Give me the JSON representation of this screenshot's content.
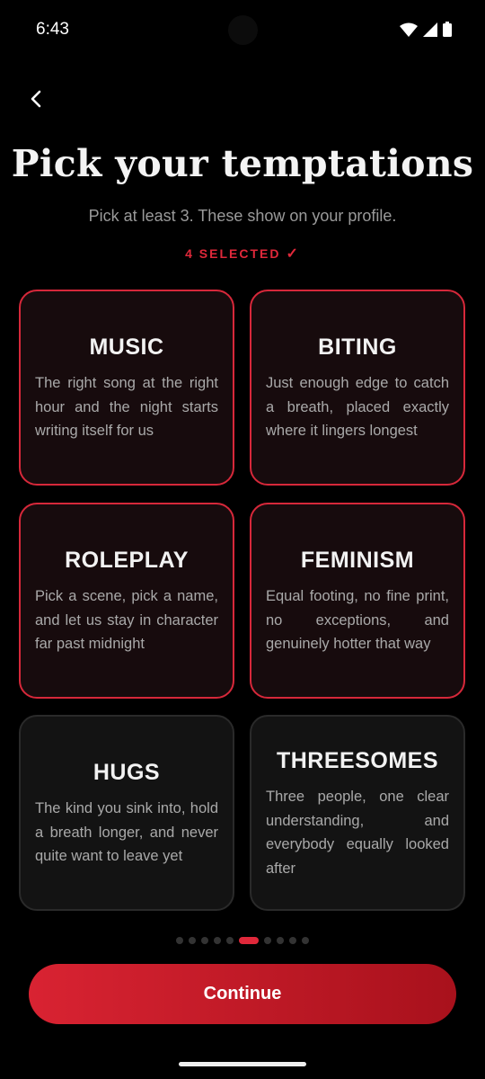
{
  "status_bar": {
    "time": "6:43",
    "icons": [
      "wifi-icon",
      "signal-icon",
      "battery-icon"
    ]
  },
  "header": {
    "back_icon": "chevron-left-icon",
    "title": "Pick your temptations",
    "subtitle": "Pick at least 3. These show on your profile.",
    "selected_text": "4 SELECTED",
    "selected_check": "✓"
  },
  "cards": [
    {
      "title": "MUSIC",
      "description": "The right song at the right hour and the night starts writing itself for us",
      "selected": true
    },
    {
      "title": "BITING",
      "description": "Just enough edge to catch a breath, placed exactly where it lingers longest",
      "selected": true
    },
    {
      "title": "ROLEPLAY",
      "description": "Pick a scene, pick a name, and let us stay in character far past midnight",
      "selected": true
    },
    {
      "title": "FEMINISM",
      "description": "Equal footing, no fine print, no exceptions, and genuinely hotter that way",
      "selected": true
    },
    {
      "title": "HUGS",
      "description": "The kind you sink into, hold a breath longer, and never quite want to leave yet",
      "selected": false
    },
    {
      "title": "THREESOMES",
      "description": "Three people, one clear understanding, and everybody equally looked after",
      "selected": false
    }
  ],
  "pagination": {
    "total": 10,
    "active_index": 5
  },
  "continue_label": "Continue",
  "colors": {
    "accent": "#e0283a",
    "background": "#000000",
    "card_selected_bg": "#170b0d",
    "card_bg": "#131313"
  }
}
